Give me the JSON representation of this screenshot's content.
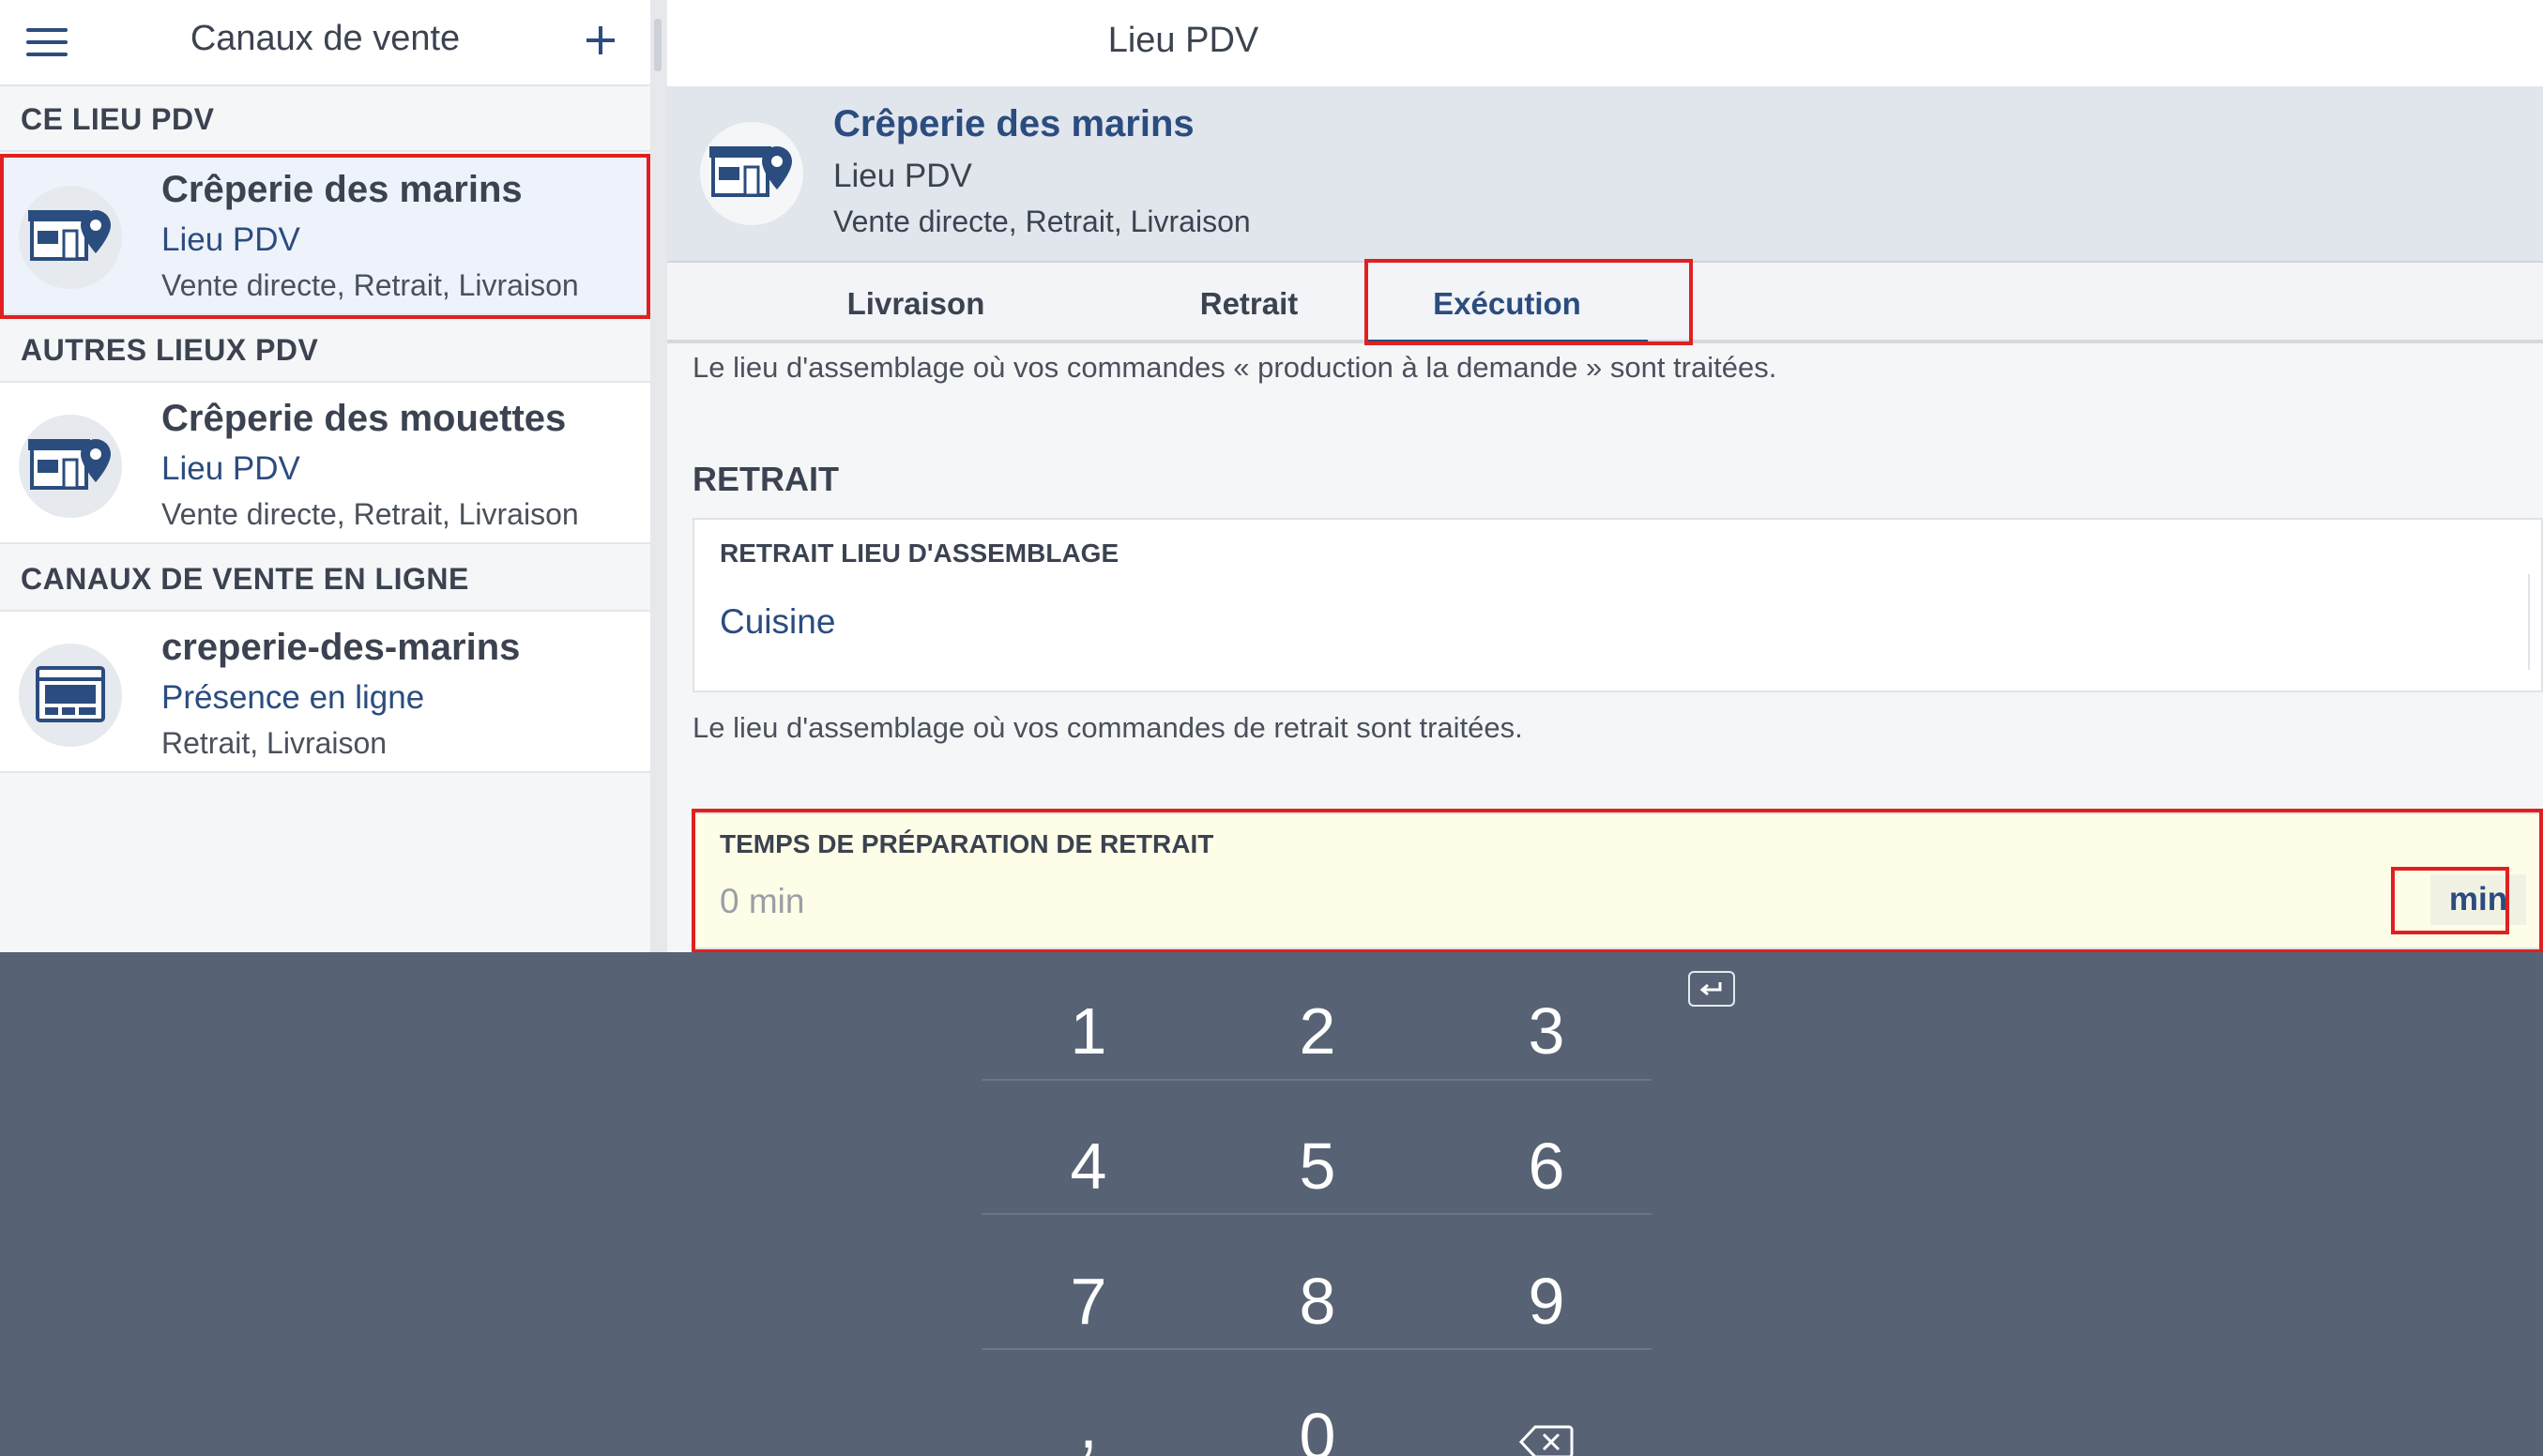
{
  "sidebar": {
    "title": "Canaux de vente",
    "sections": {
      "this_location": "CE LIEU PDV",
      "other_locations": "AUTRES LIEUX PDV",
      "online_channels": "CANAUX DE VENTE EN LIGNE"
    },
    "items": [
      {
        "name": "Crêperie des marins",
        "type": "Lieu PDV",
        "modes": "Vente directe, Retrait, Livraison"
      },
      {
        "name": "Crêperie des mouettes",
        "type": "Lieu PDV",
        "modes": "Vente directe, Retrait, Livraison"
      },
      {
        "name": "creperie-des-marins",
        "type": "Présence en ligne",
        "modes": "Retrait, Livraison"
      }
    ]
  },
  "main": {
    "title": "Lieu PDV",
    "location": {
      "name": "Crêperie des marins",
      "type": "Lieu PDV",
      "modes": "Vente directe, Retrait, Livraison"
    },
    "tabs": [
      "Livraison",
      "Retrait",
      "Exécution"
    ],
    "active_tab": "Exécution",
    "note_top": "Le lieu d'assemblage où vos commandes « production à la demande » sont traitées.",
    "section_title": "RETRAIT",
    "assembly_field": {
      "label": "RETRAIT LIEU D'ASSEMBLAGE",
      "value": "Cuisine"
    },
    "note_retrait": "Le lieu d'assemblage où vos commandes de retrait sont traitées.",
    "prep_time_field": {
      "label": "TEMPS DE PRÉPARATION DE RETRAIT",
      "placeholder": "0 min",
      "unit": "min"
    }
  },
  "keypad": {
    "keys": [
      "1",
      "2",
      "3",
      "4",
      "5",
      "6",
      "7",
      "8",
      "9",
      ",",
      "0"
    ],
    "icons": {
      "return": "return-icon",
      "backspace": "backspace-icon"
    }
  },
  "colors": {
    "accent": "#2b4c7e",
    "highlight": "#e02020",
    "keypad_bg": "#576274",
    "input_bg": "#fefde8"
  }
}
